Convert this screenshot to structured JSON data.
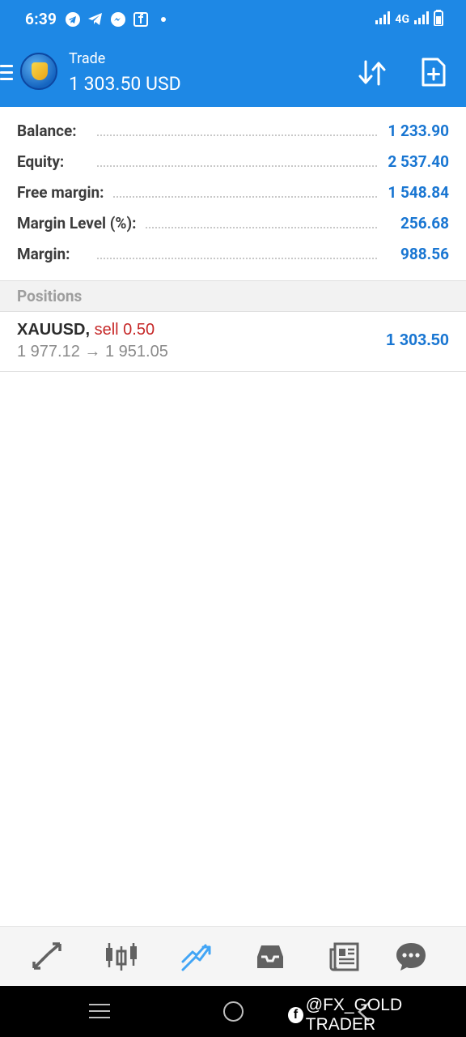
{
  "status_bar": {
    "time": "6:39",
    "network": "4G"
  },
  "header": {
    "title": "Trade",
    "balance": "1 303.50 USD"
  },
  "summary": [
    {
      "label": "Balance:",
      "value": "1 233.90"
    },
    {
      "label": "Equity:",
      "value": "2 537.40"
    },
    {
      "label": "Free margin:",
      "value": "1 548.84"
    },
    {
      "label": "Margin Level (%):",
      "value": "256.68"
    },
    {
      "label": "Margin:",
      "value": "988.56"
    }
  ],
  "positions": {
    "title": "Positions",
    "items": [
      {
        "symbol": "XAUUSD,",
        "side": "sell 0.50",
        "prices": "1 977.12 → 1 951.05",
        "profit": "1 303.50"
      }
    ]
  },
  "tabs": [
    {
      "name": "quotes",
      "icon": "arrows-icon"
    },
    {
      "name": "charts",
      "icon": "candlestick-icon"
    },
    {
      "name": "trade",
      "icon": "trend-icon",
      "active": true
    },
    {
      "name": "history",
      "icon": "inbox-icon"
    },
    {
      "name": "news",
      "icon": "news-icon"
    },
    {
      "name": "messages",
      "icon": "chat-icon"
    }
  ],
  "watermark": "@FX_GOLD TRADER",
  "colors": {
    "primary": "#1e88e5",
    "value_blue": "#1976d2",
    "sell_red": "#c62828",
    "icon_gray": "#616161"
  }
}
